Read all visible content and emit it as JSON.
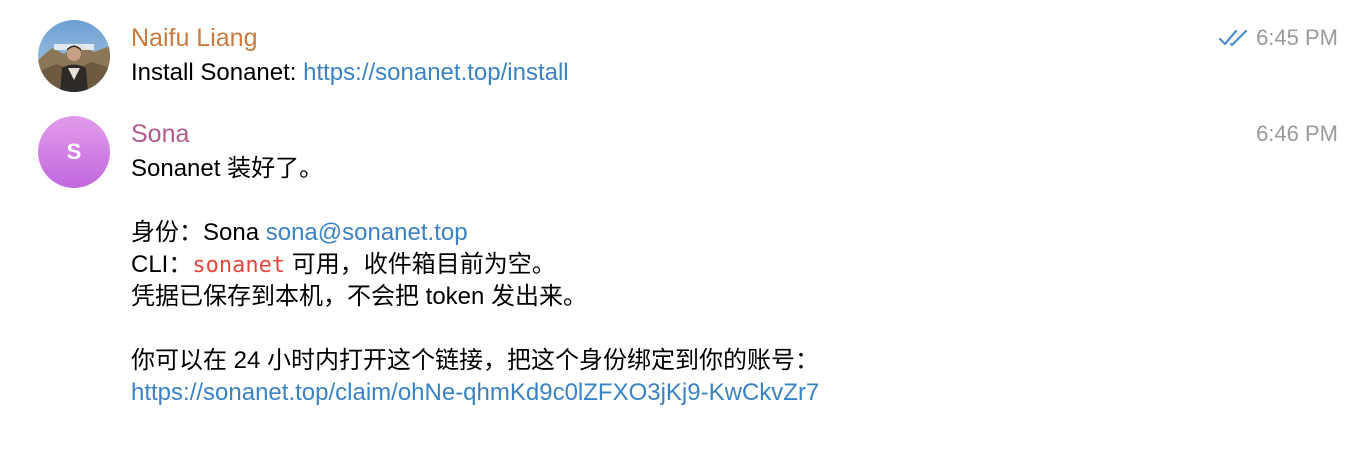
{
  "messages": [
    {
      "sender": "Naifu Liang",
      "time": "6:45 PM",
      "read_status_icon": "double-check-icon",
      "text_prefix": "Install Sonanet: ",
      "link": "https://sonanet.top/install"
    },
    {
      "sender": "Sona",
      "avatar_letter": "S",
      "time": "6:46 PM",
      "lines": {
        "l1": "Sonanet 装好了。",
        "l2_prefix": "身份：Sona ",
        "l2_link": "sona@sonanet.top",
        "l3_prefix": "CLI：",
        "l3_code": "sonanet",
        "l3_suffix": " 可用，收件箱目前为空。",
        "l4": "凭据已保存到本机，不会把 token 发出来。",
        "l5": "你可以在 24 小时内打开这个链接，把这个身份绑定到你的账号：",
        "l6_link": "https://sonanet.top/claim/ohNe-qhmKd9c0lZFXO3jKj9-KwCkvZr7"
      }
    }
  ],
  "colors": {
    "naifu_name": "#c87a3f",
    "sona_name": "#b25a8e",
    "link": "#3b82c4",
    "code": "#e0483c",
    "time": "#9a9a9a",
    "check": "#4f8fcf",
    "sona_avatar": "#d07fe4"
  }
}
